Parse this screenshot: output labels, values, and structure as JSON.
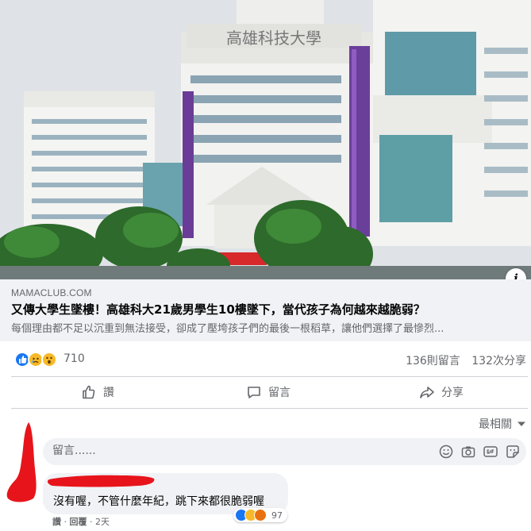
{
  "link_preview": {
    "domain": "MAMACLUB.COM",
    "title": "又傳大學生墜樓！高雄科大21歲男學生10樓墜下，當代孩子為何越來越脆弱？",
    "description": "每個理由都不足以沉重到無法接受，卻成了壓垮孩子們的最後一根稻草，讓他們選擇了最慘烈...",
    "info_label": "i",
    "photo_sign": "高雄科技大學"
  },
  "stats": {
    "reaction_count": "710",
    "comments": "136則留言",
    "shares": "132次分享",
    "reaction_icons": [
      "like-icon",
      "sad-icon",
      "wow-icon"
    ]
  },
  "actions": {
    "like": "讚",
    "comment": "留言",
    "share": "分享"
  },
  "comments": {
    "sort_label": "最相關",
    "composer_placeholder": "留言......",
    "composer_icons": [
      "emoji-icon",
      "camera-icon",
      "gif-icon",
      "sticker-icon"
    ],
    "items": [
      {
        "text": "沒有喔，不管什麼年紀，跳下來都很脆弱喔",
        "like_action": "讚",
        "reply_action": "回覆",
        "time": "2天",
        "reaction_count": "97"
      }
    ]
  },
  "colors": {
    "like_blue": "#1877f2",
    "sad_yellow": "#f7b928",
    "angry_orange": "#e9710f",
    "redaction_red": "#e8141b",
    "secondary_text": "#65676b"
  }
}
